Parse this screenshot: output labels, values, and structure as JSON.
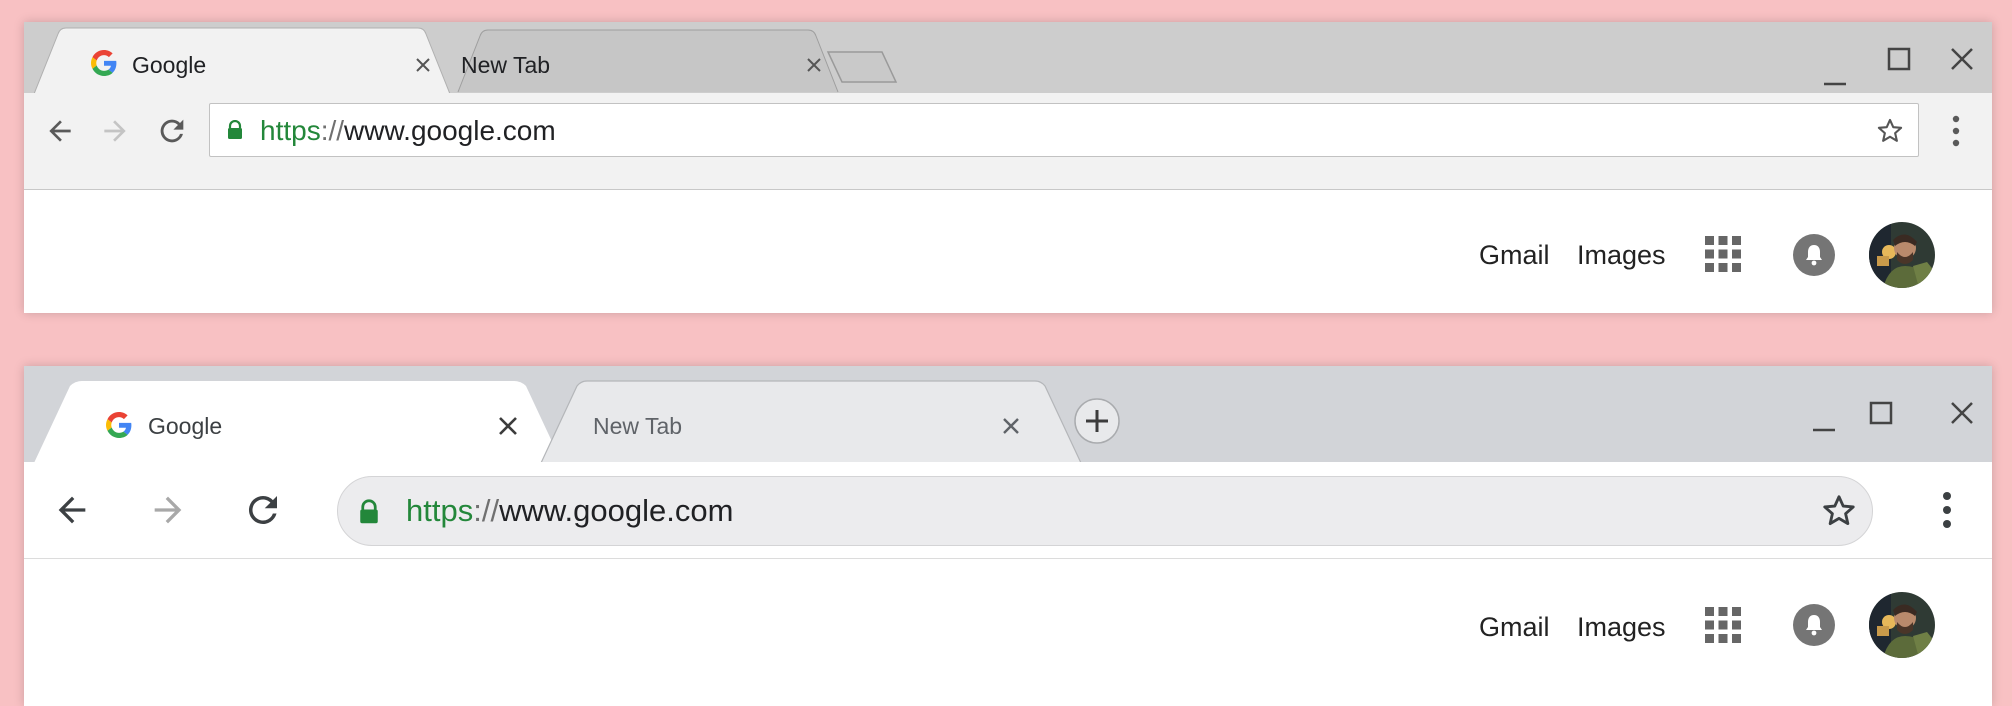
{
  "windows": [
    {
      "style": "old",
      "tabs": [
        {
          "title": "Google",
          "favicon": "google-g-icon",
          "active": true
        },
        {
          "title": "New Tab",
          "favicon": "",
          "active": false
        }
      ],
      "url": {
        "scheme": "https",
        "separator": "://",
        "host": "www.google.com"
      },
      "header_links": [
        "Gmail",
        "Images"
      ]
    },
    {
      "style": "new",
      "tabs": [
        {
          "title": "Google",
          "favicon": "google-g-icon",
          "active": true
        },
        {
          "title": "New Tab",
          "favicon": "",
          "active": false
        }
      ],
      "url": {
        "scheme": "https",
        "separator": "://",
        "host": "www.google.com"
      },
      "header_links": [
        "Gmail",
        "Images"
      ]
    }
  ],
  "colors": {
    "background": "#f8c1c3",
    "secure_green": "#23873a",
    "old_strip": "#cdcdcd",
    "new_strip": "#d2d4d8",
    "omnibox_new": "#ececee"
  }
}
